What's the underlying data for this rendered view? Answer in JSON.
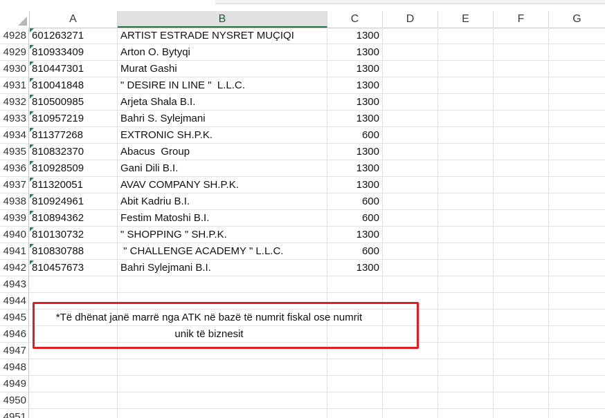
{
  "columns": [
    "A",
    "B",
    "C",
    "D",
    "E",
    "F",
    "G"
  ],
  "selected_column": "B",
  "rows": [
    {
      "num": "4928",
      "a": "601263271",
      "b": "ARTIST ESTRADE NYSRET MUÇIQI",
      "c": "1300"
    },
    {
      "num": "4929",
      "a": "810933409",
      "b": "Arton O. Bytyqi",
      "c": "1300"
    },
    {
      "num": "4930",
      "a": "810447301",
      "b": "Murat Gashi",
      "c": "1300"
    },
    {
      "num": "4931",
      "a": "810041848",
      "b": "\" DESIRE IN LINE \"  L.L.C.",
      "c": "1300"
    },
    {
      "num": "4932",
      "a": "810500985",
      "b": "Arjeta Shala B.I.",
      "c": "1300"
    },
    {
      "num": "4933",
      "a": "810957219",
      "b": "Bahri S. Sylejmani",
      "c": "1300"
    },
    {
      "num": "4934",
      "a": "811377268",
      "b": "EXTRONIC SH.P.K.",
      "c": "600"
    },
    {
      "num": "4935",
      "a": "810832370",
      "b": "Abacus  Group",
      "c": "1300"
    },
    {
      "num": "4936",
      "a": "810928509",
      "b": "Gani Dili B.I.",
      "c": "1300"
    },
    {
      "num": "4937",
      "a": "811320051",
      "b": "AVAV COMPANY SH.P.K.",
      "c": "1300"
    },
    {
      "num": "4938",
      "a": "810924961",
      "b": "Abit Kadriu B.I.",
      "c": "600"
    },
    {
      "num": "4939",
      "a": "810894362",
      "b": "Festim Matoshi B.I.",
      "c": "600"
    },
    {
      "num": "4940",
      "a": "810130732",
      "b": "\" SHOPPING \" SH.P.K.",
      "c": "1300"
    },
    {
      "num": "4941",
      "a": "810830788",
      "b": " \" CHALLENGE ACADEMY \" L.L.C.",
      "c": "600"
    },
    {
      "num": "4942",
      "a": "810457673",
      "b": "Bahri Sylejmani B.I.",
      "c": "1300"
    },
    {
      "num": "4943",
      "a": "",
      "b": "",
      "c": ""
    },
    {
      "num": "4944",
      "a": "",
      "b": "",
      "c": ""
    },
    {
      "num": "4945",
      "a": "",
      "b": "",
      "c": ""
    },
    {
      "num": "4946",
      "a": "",
      "b": "",
      "c": ""
    },
    {
      "num": "4947",
      "a": "",
      "b": "",
      "c": ""
    },
    {
      "num": "4948",
      "a": "",
      "b": "",
      "c": ""
    },
    {
      "num": "4949",
      "a": "",
      "b": "",
      "c": ""
    },
    {
      "num": "4950",
      "a": "",
      "b": "",
      "c": ""
    },
    {
      "num": "4951",
      "a": "",
      "b": "",
      "c": ""
    }
  ],
  "note": {
    "line1": "*Të dhënat janë marrë nga ATK në bazë të numrit fiskal ose numrit",
    "line2": "unik të biznesit"
  },
  "colors": {
    "note_border": "#e31b23",
    "selected_header": "#217346",
    "number_stored_as_text_flag": "#1e8c3d"
  }
}
